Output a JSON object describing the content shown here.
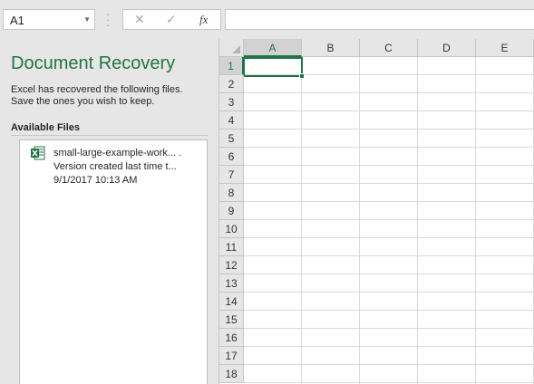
{
  "formula_bar": {
    "name_box": "A1",
    "cancel_glyph": "✕",
    "enter_glyph": "✓",
    "fx_label": "fx",
    "formula": ""
  },
  "recovery": {
    "title": "Document Recovery",
    "description_line1": "Excel has recovered the following files.",
    "description_line2": "Save the ones you wish to keep.",
    "available_files_label": "Available Files",
    "files": [
      {
        "name": "small-large-example-work... .",
        "version": "Version created last time t...",
        "timestamp": "9/1/2017 10:13 AM",
        "icon": "excel-file-icon"
      }
    ]
  },
  "grid": {
    "columns": [
      "A",
      "B",
      "C",
      "D",
      "E"
    ],
    "rows": [
      "1",
      "2",
      "3",
      "4",
      "5",
      "6",
      "7",
      "8",
      "9",
      "10",
      "11",
      "12",
      "13",
      "14",
      "15",
      "16",
      "17",
      "18"
    ],
    "selected_cell": "A1"
  },
  "colors": {
    "accent": "#217346",
    "pane_bg": "#e6e6e6",
    "gridline": "#d9d9d9"
  }
}
